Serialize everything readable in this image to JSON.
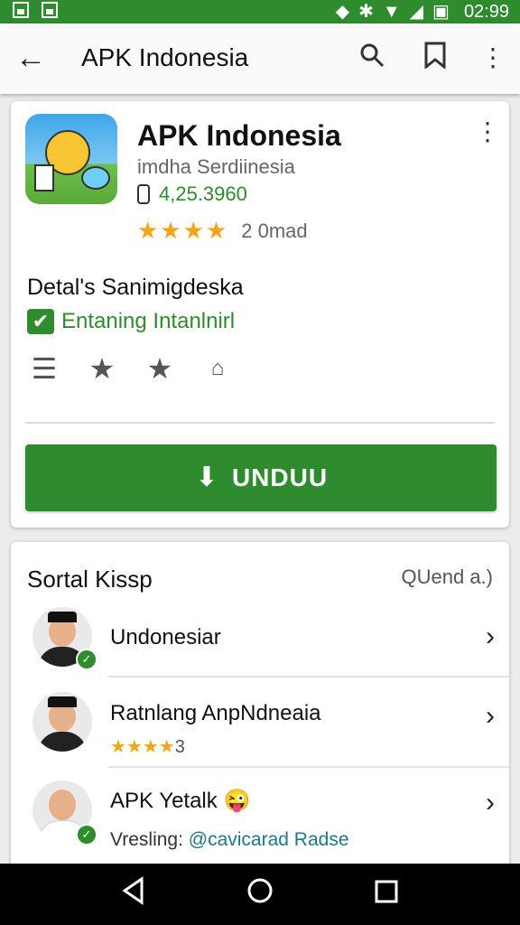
{
  "statusbar": {
    "time": "02:99",
    "left_icons": [
      "image-icon",
      "image-icon"
    ],
    "right_icons": [
      "signal-icon",
      "bluetooth-icon",
      "wifi-icon",
      "cell-icon",
      "battery-icon"
    ]
  },
  "appbar": {
    "title": "APK Indonesia",
    "back_icon": "arrow-left-icon",
    "actions": [
      "search-icon",
      "bookmark-icon",
      "more-vert-icon"
    ]
  },
  "app": {
    "name": "APK Indonesia",
    "subtitle": "imdha Serdiinesia",
    "version": "4,25.3960",
    "stars": "★★★★",
    "rating_text": "2 0mad"
  },
  "details": {
    "title": "Detal's Sanimigdeska",
    "status": "Entaning Intanlnirl",
    "icons": [
      "list-icon",
      "star-icon",
      "star-icon",
      "share-icon"
    ]
  },
  "download": {
    "label": "UNDUU",
    "icon": "download-icon"
  },
  "section": {
    "title": "Sortal Kissp",
    "link": "QUend a.)",
    "items": [
      {
        "title": "Undonesiar",
        "sub": ""
      },
      {
        "title": "Ratnlang AnpNdneaia",
        "sub_stars": "★★★★",
        "sub": "3"
      },
      {
        "title": "APK Yetalk",
        "emoji": "😜",
        "sub_prefix": "Vresling: ",
        "sub_link": "@cavicarad Radse"
      }
    ]
  },
  "colors": {
    "primary": "#2e8b2e",
    "star": "#f2a516",
    "link": "#1a7a8a"
  },
  "navbar": [
    "back-triangle-icon",
    "home-circle-icon",
    "recents-square-icon"
  ]
}
